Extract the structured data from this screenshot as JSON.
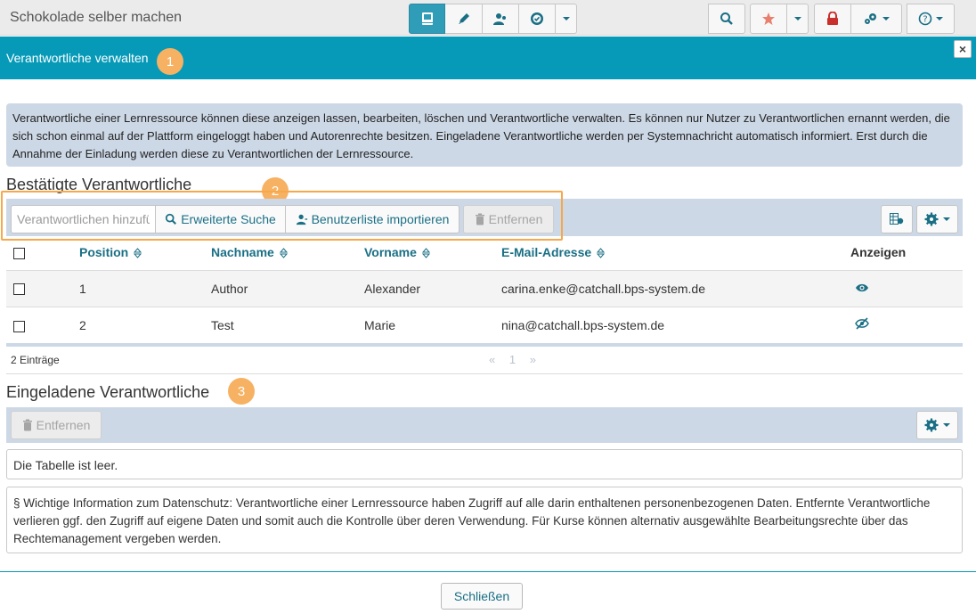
{
  "app": {
    "title": "Schokolade selber machen"
  },
  "topbar": {
    "left_group": [
      {
        "icon": "book-icon",
        "active": true
      },
      {
        "icon": "pencil-icon",
        "active": false
      },
      {
        "icon": "users-icon",
        "active": false
      },
      {
        "icon": "badge-icon",
        "active": false
      },
      {
        "icon": "chevron-down-icon",
        "active": false
      }
    ],
    "right_groups": [
      "search-icon",
      "star-icon",
      "lock-icon",
      "gears-icon",
      "help-icon"
    ]
  },
  "modal": {
    "title": "Verantwortliche verwalten",
    "badges": [
      "1",
      "2",
      "3"
    ],
    "info": "Verantwortliche einer Lernressource können diese anzeigen lassen, bearbeiten, löschen und Verantwortliche verwalten. Es können nur Nutzer zu Verantwortlichen ernannt werden, die sich schon einmal auf der Plattform eingeloggt haben und Autorenrechte besitzen. Eingeladene Verantwortliche werden per Systemnachricht automatisch informiert. Erst durch die Annahme der Einladung werden diese zu Verantwortlichen der Lernressource."
  },
  "confirmed": {
    "title": "Bestätigte Verantwortliche",
    "search_placeholder": "Verantwortlichen hinzufügen",
    "advanced_search": "Erweiterte Suche",
    "import_list": "Benutzerliste importieren",
    "remove": "Entfernen",
    "columns": [
      "Position",
      "Nachname",
      "Vorname",
      "E-Mail-Adresse",
      "Anzeigen"
    ],
    "rows": [
      {
        "position": "1",
        "lastname": "Author",
        "firstname": "Alexander",
        "email": "carina.enke@catchall.bps-system.de",
        "visible": true
      },
      {
        "position": "2",
        "lastname": "Test",
        "firstname": "Marie",
        "email": "nina@catchall.bps-system.de",
        "visible": false
      }
    ],
    "count": "2 Einträge",
    "pager": {
      "prev": "«",
      "page": "1",
      "next": "»"
    }
  },
  "invited": {
    "title": "Eingeladene Verantwortliche",
    "remove": "Entfernen",
    "empty": "Die Tabelle ist leer."
  },
  "privacy": "§ Wichtige Information zum Datenschutz: Verantwortliche einer Lernressource haben Zugriff auf alle darin enthaltenen personenbezogenen Daten. Entfernte Verantwortliche verlieren ggf. den Zugriff auf eigene Daten und somit auch die Kontrolle über deren Verwendung. Für Kurse können alternativ ausgewählte Bearbeitungsrechte über das Rechtemanagement vergeben werden.",
  "footer": {
    "close": "Schließen"
  },
  "colors": {
    "accent": "#069ab8",
    "toolbar_bg": "#cdd8e6",
    "badge": "#f7b162",
    "link": "#1a6f85"
  }
}
